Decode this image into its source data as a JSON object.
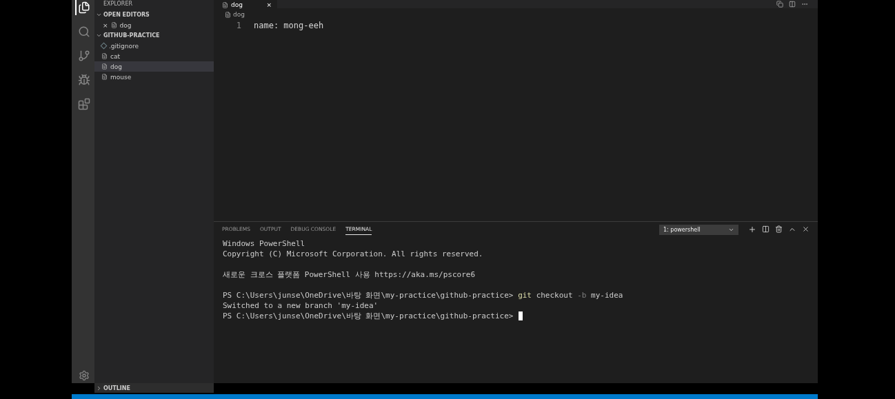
{
  "activity_bar": [
    {
      "kind": "files",
      "selected": true
    },
    {
      "kind": "search",
      "selected": false
    },
    {
      "kind": "source-control",
      "selected": false
    },
    {
      "kind": "debug",
      "selected": false
    },
    {
      "kind": "extensions",
      "selected": false
    }
  ],
  "sidebar": {
    "title": "EXPLORER",
    "sections": [
      {
        "title": "OPEN EDITORS",
        "expanded": true,
        "items": [
          {
            "close": "×",
            "name": "dog",
            "selected": false
          }
        ]
      },
      {
        "title": "GITHUB-PRACTICE",
        "expanded": true,
        "items": [
          {
            "name": ".gitignore",
            "kind": "ignore",
            "selected": false
          },
          {
            "name": "cat",
            "kind": "file",
            "selected": false
          },
          {
            "name": "dog",
            "kind": "file",
            "selected": true
          },
          {
            "name": "mouse",
            "kind": "file",
            "selected": false
          }
        ]
      }
    ],
    "outline": {
      "title": "OUTLINE",
      "expanded": false
    }
  },
  "editor": {
    "tab": {
      "name": "dog",
      "close": "×"
    },
    "breadcrumb": "dog",
    "lines": [
      {
        "number": "1",
        "text": "name: mong-eeh"
      }
    ]
  },
  "panel": {
    "tabs": [
      {
        "label": "PROBLEMS",
        "selected": false
      },
      {
        "label": "OUTPUT",
        "selected": false
      },
      {
        "label": "DEBUG CONSOLE",
        "selected": false
      },
      {
        "label": "TERMINAL",
        "selected": true
      }
    ],
    "terminal_select": "1: powershell",
    "lines": [
      {
        "kind": "output",
        "text": "Windows PowerShell"
      },
      {
        "kind": "output",
        "text": "Copyright (C) Microsoft Corporation. All rights reserved."
      },
      {
        "kind": "blank"
      },
      {
        "kind": "output",
        "text": "새로운 크로스 플랫폼 PowerShell 사용 https://aka.ms/pscore6"
      },
      {
        "kind": "blank"
      },
      {
        "kind": "prompt",
        "prompt": "PS C:\\Users\\junse\\OneDrive\\바탕 화면\\my-practice\\github-practice>",
        "command": "git",
        "args": [
          {
            "text": "checkout",
            "dim": false
          },
          {
            "text": "-b",
            "dim": true
          },
          {
            "text": "my-idea",
            "dim": false
          }
        ]
      },
      {
        "kind": "output",
        "text": "Switched to a new branch 'my-idea'"
      },
      {
        "kind": "prompt",
        "prompt": "PS C:\\Users\\junse\\OneDrive\\바탕 화면\\my-practice\\github-practice>",
        "cursor": true
      }
    ]
  }
}
